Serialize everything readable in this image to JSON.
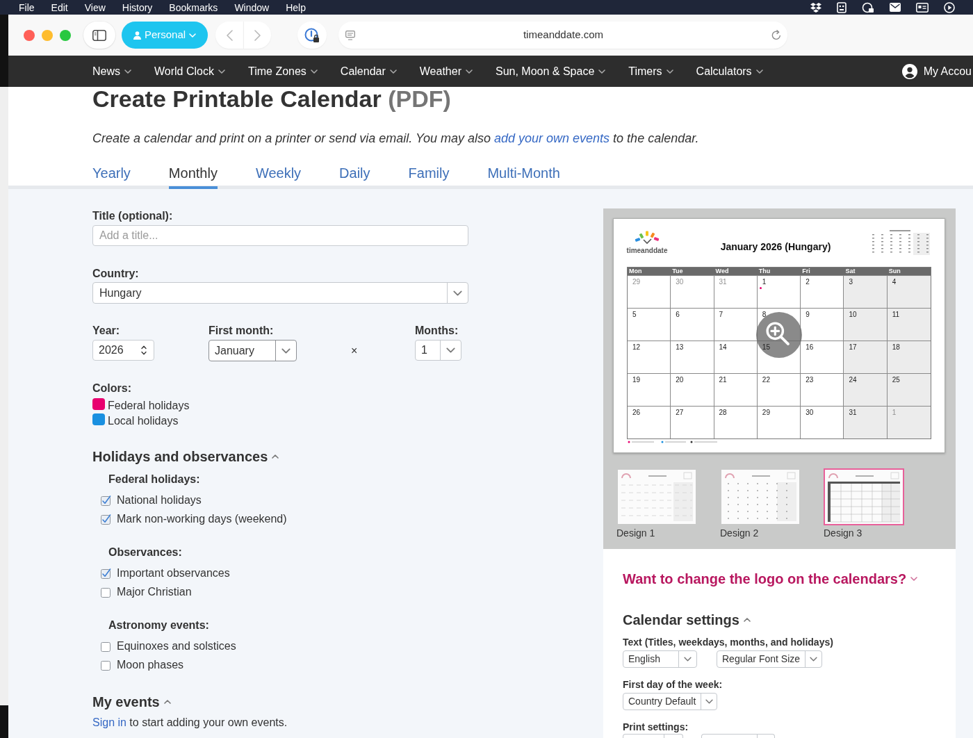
{
  "menu_bar": {
    "items": [
      "File",
      "Edit",
      "View",
      "History",
      "Bookmarks",
      "Window",
      "Help"
    ]
  },
  "browser": {
    "profile": "Personal",
    "address": "timeanddate.com"
  },
  "nav": {
    "items": [
      "News",
      "World Clock",
      "Time Zones",
      "Calendar",
      "Weather",
      "Sun, Moon & Space",
      "Timers",
      "Calculators"
    ],
    "account": "My Accou"
  },
  "header": {
    "title": "Create Printable Calendar",
    "title_suffix": "(PDF)",
    "intro": {
      "before": "Create a calendar and print on a printer or send via email. You may also ",
      "link": "add your own events",
      "after": " to the calendar."
    }
  },
  "tabs": [
    {
      "label": "Yearly",
      "selected": false
    },
    {
      "label": "Monthly",
      "selected": true
    },
    {
      "label": "Weekly",
      "selected": false
    },
    {
      "label": "Daily",
      "selected": false
    },
    {
      "label": "Family",
      "selected": false
    },
    {
      "label": "Multi-Month",
      "selected": false
    }
  ],
  "form": {
    "title_field": {
      "label": "Title (optional):",
      "placeholder": "Add a title..."
    },
    "country": {
      "label": "Country:",
      "value": "Hungary"
    },
    "year": {
      "label": "Year:",
      "value": "2026"
    },
    "first_month": {
      "label": "First month:",
      "value": "January"
    },
    "times_sign": "×",
    "months": {
      "label": "Months:",
      "value": "1"
    },
    "colors": {
      "label": "Colors:",
      "items": [
        {
          "label": "Federal holidays",
          "color": "#e8006f"
        },
        {
          "label": "Local holidays",
          "color": "#1a90e0"
        }
      ]
    }
  },
  "holidays": {
    "title": "Holidays and observances",
    "expanded": true,
    "groups": [
      {
        "title": "Federal holidays:",
        "options": [
          {
            "label": "National holidays",
            "checked": true
          },
          {
            "label": "Mark non-working days (weekend)",
            "checked": true
          }
        ]
      },
      {
        "title": "Observances:",
        "options": [
          {
            "label": "Important observances",
            "checked": true
          },
          {
            "label": "Major Christian",
            "checked": false
          }
        ]
      },
      {
        "title": "Astronomy events:",
        "options": [
          {
            "label": "Equinoxes and solstices",
            "checked": false
          },
          {
            "label": "Moon phases",
            "checked": false
          }
        ]
      }
    ]
  },
  "my_events": {
    "title": "My events",
    "expanded": true,
    "link": "Sign in",
    "text": " to start adding your own events."
  },
  "preview": {
    "logo_text": "timeanddate",
    "title": "January 2026 (Hungary)",
    "weekdays": [
      {
        "label": "Mon",
        "weekend": false
      },
      {
        "label": "Tue",
        "weekend": false
      },
      {
        "label": "Wed",
        "weekend": false
      },
      {
        "label": "Thu",
        "weekend": false
      },
      {
        "label": "Fri",
        "weekend": false
      },
      {
        "label": "Sat",
        "weekend": true
      },
      {
        "label": "Sun",
        "weekend": true
      }
    ],
    "weeks": [
      [
        {
          "day": "29",
          "outside": true,
          "holiday": false
        },
        {
          "day": "30",
          "outside": true,
          "holiday": false
        },
        {
          "day": "31",
          "outside": true,
          "holiday": false
        },
        {
          "day": "1",
          "outside": false,
          "holiday": true
        },
        {
          "day": "2",
          "outside": false,
          "holiday": false
        },
        {
          "day": "3",
          "outside": false,
          "holiday": false
        },
        {
          "day": "4",
          "outside": false,
          "holiday": false
        }
      ],
      [
        {
          "day": "5",
          "outside": false,
          "holiday": false
        },
        {
          "day": "6",
          "outside": false,
          "holiday": false
        },
        {
          "day": "7",
          "outside": false,
          "holiday": false
        },
        {
          "day": "8",
          "outside": false,
          "holiday": false
        },
        {
          "day": "9",
          "outside": false,
          "holiday": false
        },
        {
          "day": "10",
          "outside": false,
          "holiday": false
        },
        {
          "day": "11",
          "outside": false,
          "holiday": false
        }
      ],
      [
        {
          "day": "12",
          "outside": false,
          "holiday": false
        },
        {
          "day": "13",
          "outside": false,
          "holiday": false
        },
        {
          "day": "14",
          "outside": false,
          "holiday": false
        },
        {
          "day": "15",
          "outside": false,
          "holiday": false
        },
        {
          "day": "16",
          "outside": false,
          "holiday": false
        },
        {
          "day": "17",
          "outside": false,
          "holiday": false
        },
        {
          "day": "18",
          "outside": false,
          "holiday": false
        }
      ],
      [
        {
          "day": "19",
          "outside": false,
          "holiday": false
        },
        {
          "day": "20",
          "outside": false,
          "holiday": false
        },
        {
          "day": "21",
          "outside": false,
          "holiday": false
        },
        {
          "day": "22",
          "outside": false,
          "holiday": false
        },
        {
          "day": "23",
          "outside": false,
          "holiday": false
        },
        {
          "day": "24",
          "outside": false,
          "holiday": false
        },
        {
          "day": "25",
          "outside": false,
          "holiday": false
        }
      ],
      [
        {
          "day": "26",
          "outside": false,
          "holiday": false
        },
        {
          "day": "27",
          "outside": false,
          "holiday": false
        },
        {
          "day": "28",
          "outside": false,
          "holiday": false
        },
        {
          "day": "29",
          "outside": false,
          "holiday": false
        },
        {
          "day": "30",
          "outside": false,
          "holiday": false
        },
        {
          "day": "31",
          "outside": false,
          "holiday": false
        },
        {
          "day": "1",
          "outside": true,
          "holiday": false
        }
      ]
    ]
  },
  "designs": [
    {
      "label": "Design 1",
      "kind": "lines",
      "selected": false
    },
    {
      "label": "Design 2",
      "kind": "dots",
      "selected": false
    },
    {
      "label": "Design 3",
      "kind": "grid",
      "selected": true
    }
  ],
  "logo_section": {
    "title": "Want to change the logo on the calendars?",
    "expanded": false
  },
  "settings": {
    "title": "Calendar settings",
    "expanded": true,
    "text_label": "Text (Titles, weekdays, months, and holidays)",
    "language": "English",
    "font_size": "Regular Font Size",
    "first_day_label": "First day of the week:",
    "first_day": "Country Default",
    "print_label": "Print settings:"
  }
}
